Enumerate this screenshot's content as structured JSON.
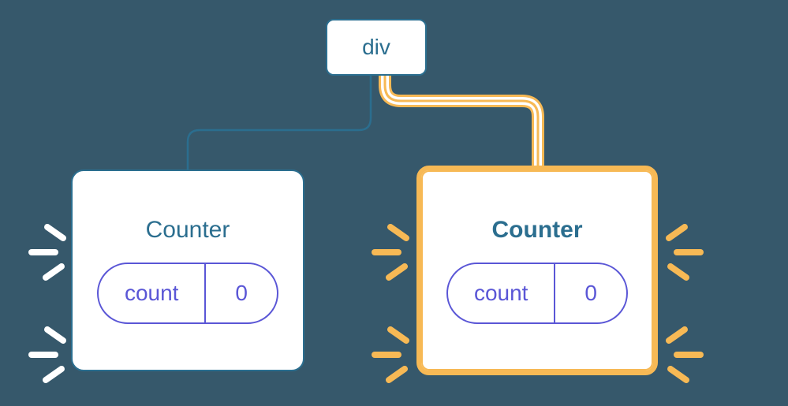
{
  "root": {
    "label": "div"
  },
  "left": {
    "title": "Counter",
    "pill_label": "count",
    "pill_value": "0"
  },
  "right": {
    "title": "Counter",
    "pill_label": "count",
    "pill_value": "0"
  },
  "colors": {
    "bg": "#36586b",
    "blue": "#2b6e8f",
    "purple": "#5a56d6",
    "yellow": "#f7b955",
    "white": "#ffffff"
  }
}
